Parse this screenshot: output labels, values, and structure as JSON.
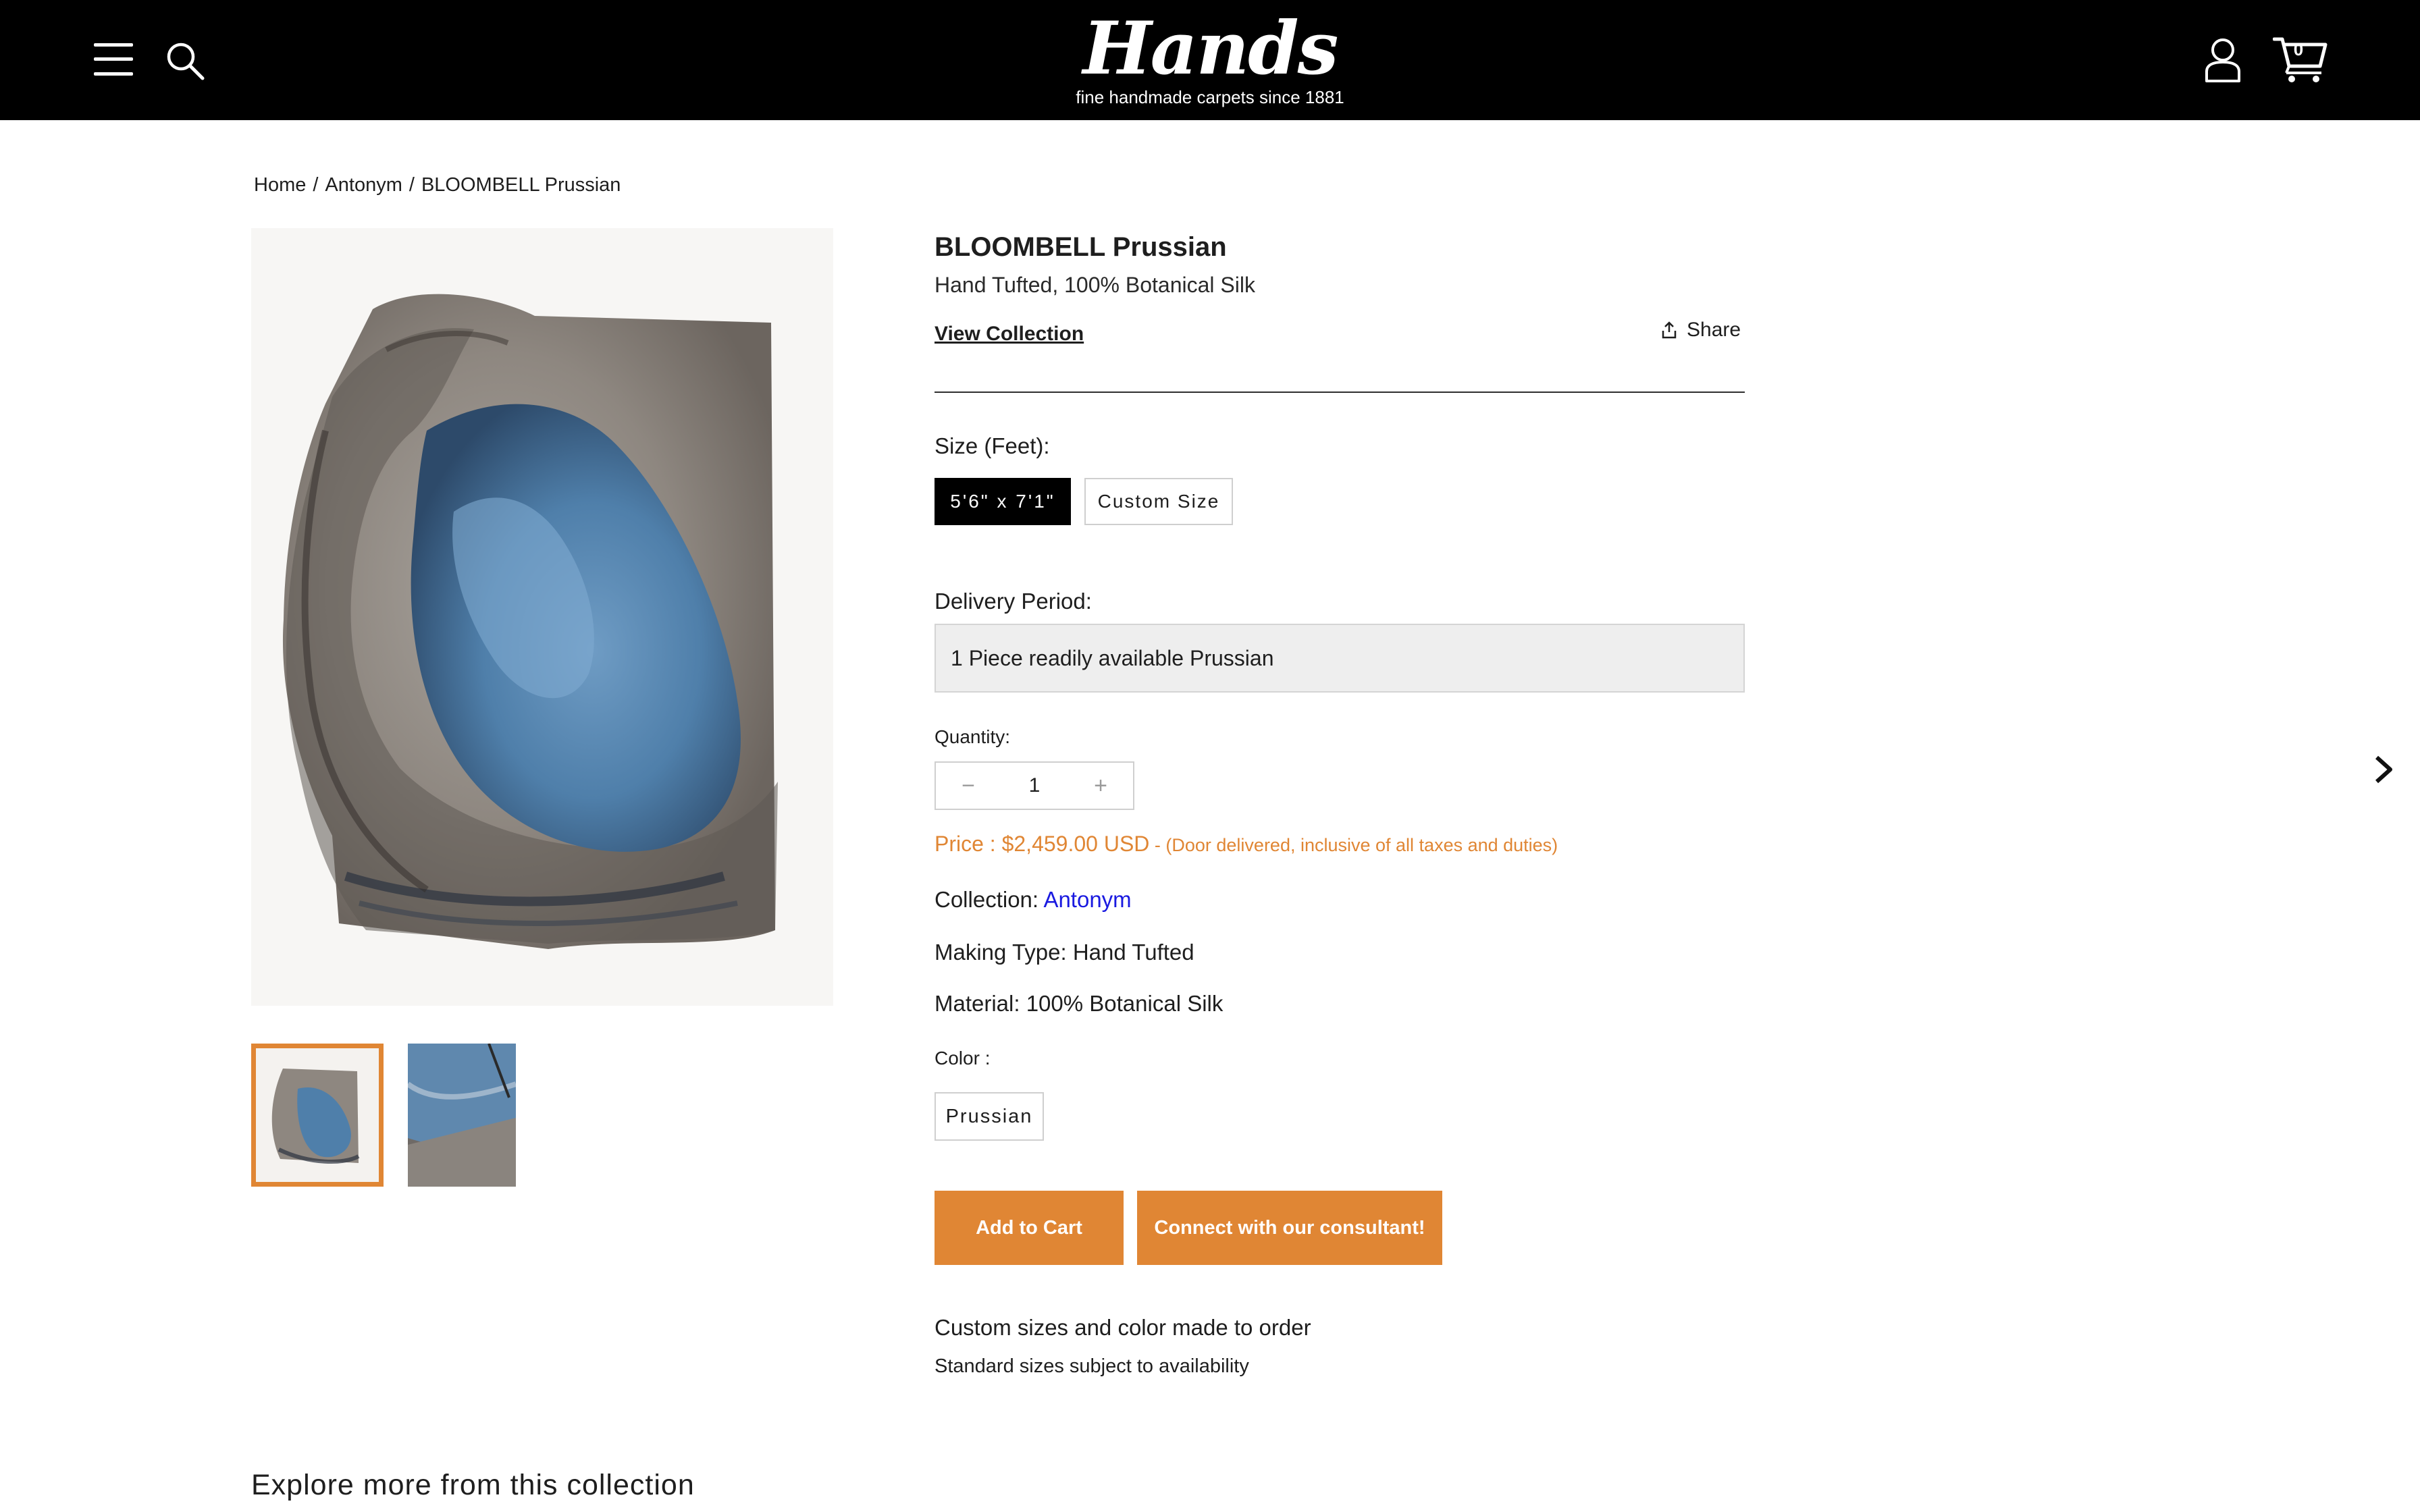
{
  "header": {
    "brand": "Hands",
    "registered_mark": "®",
    "tagline": "fine handmade carpets since 1881",
    "cart_count": "0",
    "icons": [
      "menu-icon",
      "search-icon",
      "user-icon",
      "cart-icon"
    ]
  },
  "breadcrumb": {
    "home": "Home",
    "sep": "/",
    "collection": "Antonym",
    "current": "BLOOMBELL Prussian"
  },
  "product": {
    "title": "BLOOMBELL Prussian",
    "subtitle": "Hand Tufted, 100% Botanical Silk",
    "view_collection": "View Collection",
    "share": "Share",
    "size_label": "Size (Feet):",
    "sizes": [
      "5'6\" x 7'1\"",
      "Custom Size"
    ],
    "selected_size": "5'6\" x 7'1\"",
    "delivery_label": "Delivery Period:",
    "delivery_value": "1 Piece readily available Prussian",
    "quantity_label": "Quantity:",
    "quantity": "1",
    "qty_minus": "−",
    "qty_plus": "+",
    "price_text": "Price : $2,459.00 USD",
    "price_note": " - (Door delivered, inclusive of all taxes and duties)",
    "collection_label": "Collection:",
    "collection_value": "Antonym",
    "making_type": "Making Type: Hand Tufted",
    "material": "Material: 100% Botanical Silk",
    "color_label": "Color :",
    "color_value": "Prussian",
    "add_to_cart": "Add to Cart",
    "connect": "Connect with our consultant!",
    "note_custom": "Custom sizes and color made to order",
    "note_standard": "Standard sizes subject to availability"
  },
  "explore_heading": "Explore more from this collection",
  "colors": {
    "accent": "#e08634",
    "link": "#1a1ae0",
    "header_bg": "#000000",
    "rug_blue": "#4f7faa",
    "rug_taupe": "#8e8780"
  }
}
